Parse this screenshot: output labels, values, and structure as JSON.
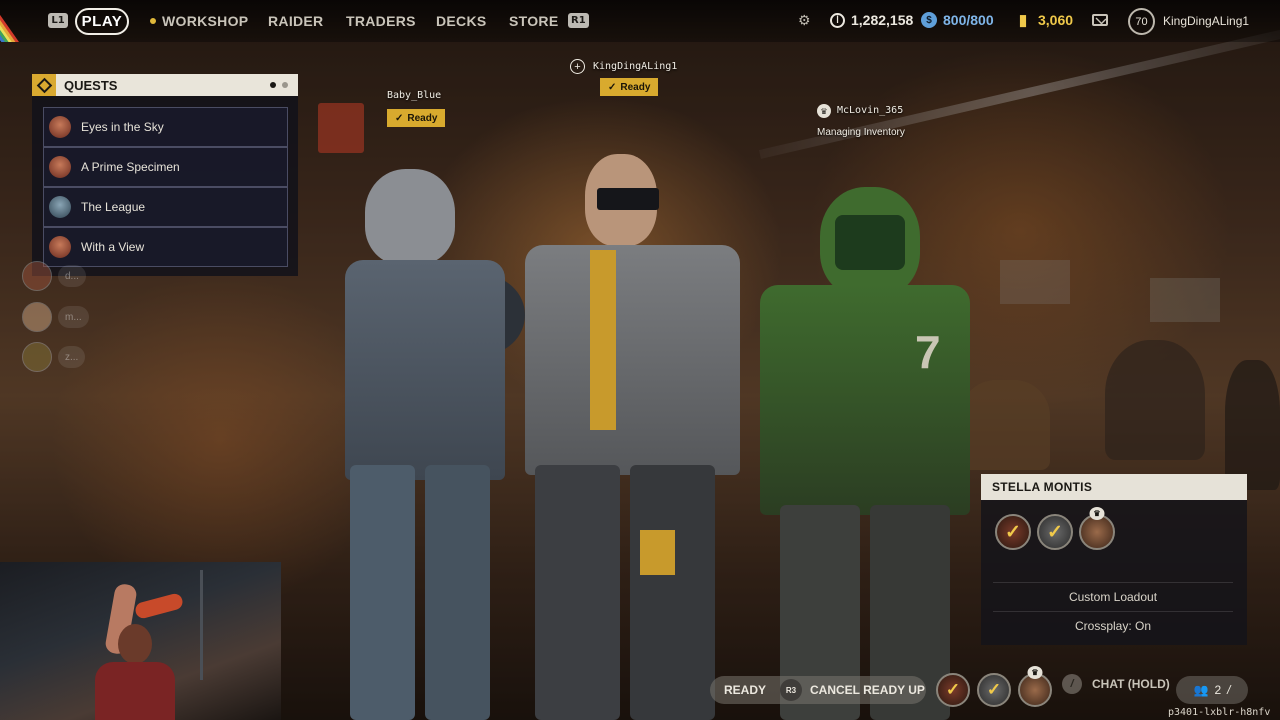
{
  "topbar": {
    "l1": "L1",
    "play": "PLAY",
    "nav": [
      "WORKSHOP",
      "RAIDER",
      "TRADERS",
      "DECKS",
      "STORE"
    ],
    "r1": "R1",
    "r3": "R3",
    "coins": "1,282,158",
    "energy": "800/800",
    "bars": "3,060",
    "level": "70",
    "username": "KingDingALing1"
  },
  "quests": {
    "title": "QUESTS",
    "items": [
      "Eyes in the Sky",
      "A Prime Specimen",
      "The League",
      "With a View"
    ]
  },
  "ghost_friends": [
    "d...",
    "m...",
    "z..."
  ],
  "players": {
    "left": {
      "name": "Baby_Blue",
      "status": "Ready"
    },
    "center": {
      "name": "KingDingALing1",
      "status": "Ready"
    },
    "right": {
      "name": "McLovin_365",
      "status": "Managing Inventory"
    }
  },
  "squad": {
    "title": "STELLA MONTIS",
    "loadout": "Custom Loadout",
    "crossplay": "Crossplay: On"
  },
  "bottom": {
    "ready": "READY",
    "r3": "R3",
    "cancel": "CANCEL READY UP",
    "chat": "CHAT (HOLD)",
    "party_count": "2",
    "session": "p3401-lxblr-h8nfv"
  },
  "colors": {
    "accent_gold": "#d8aa2e",
    "energy_blue": "#5f9fd9",
    "panel_header": "#e9e5da"
  }
}
